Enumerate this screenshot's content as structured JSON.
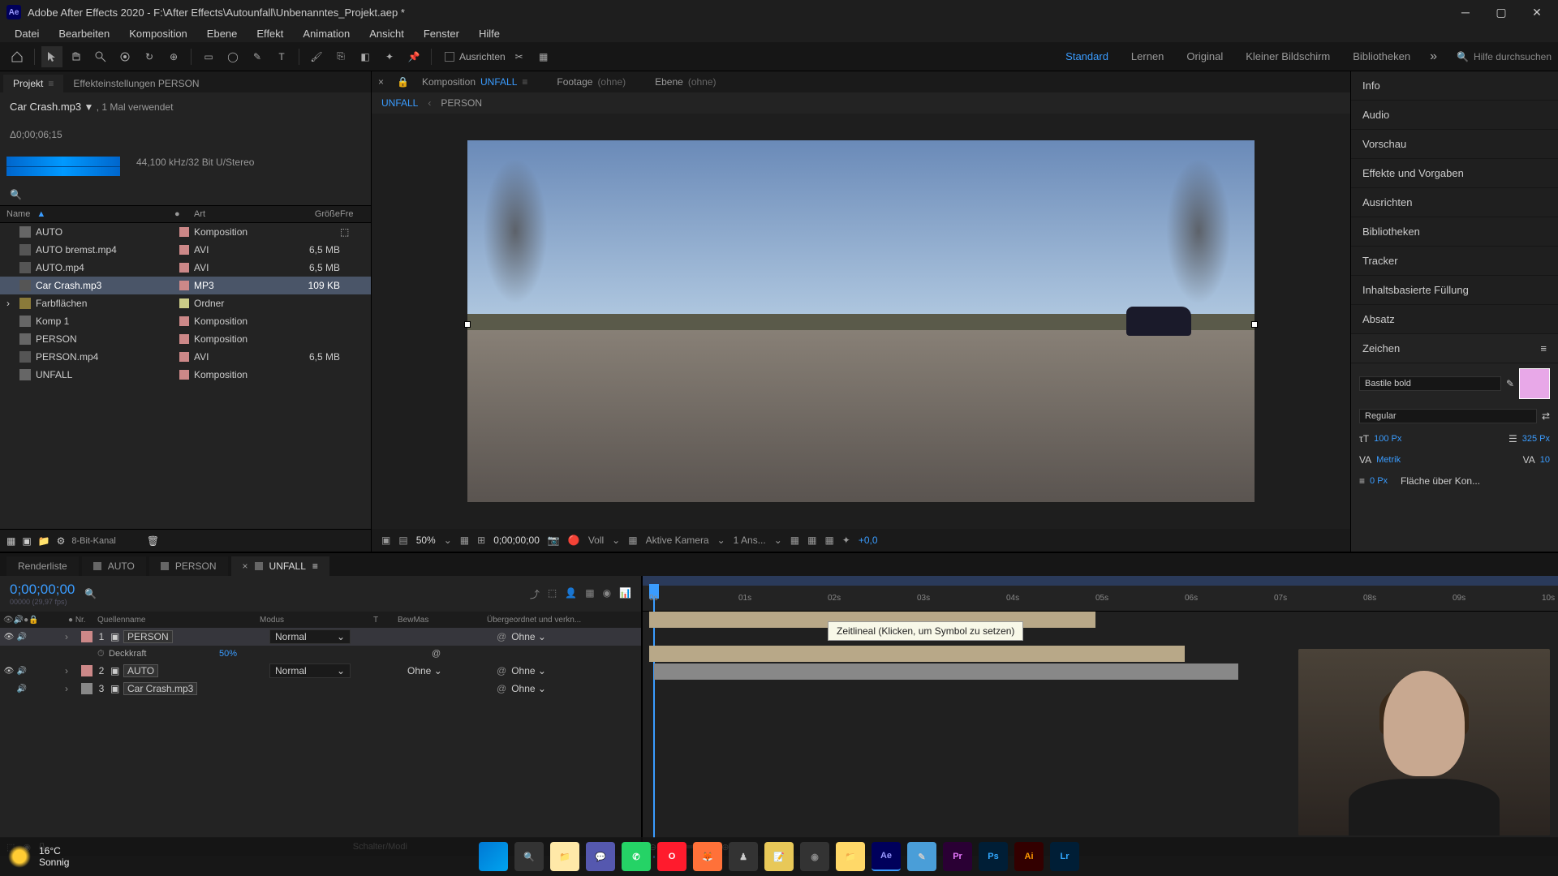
{
  "window": {
    "title": "Adobe After Effects 2020 - F:\\After Effects\\Autounfall\\Unbenanntes_Projekt.aep *"
  },
  "menu": [
    "Datei",
    "Bearbeiten",
    "Komposition",
    "Ebene",
    "Effekt",
    "Animation",
    "Ansicht",
    "Fenster",
    "Hilfe"
  ],
  "toolbar": {
    "ausrichten": "Ausrichten",
    "workspaces": [
      "Standard",
      "Lernen",
      "Original",
      "Kleiner Bildschirm",
      "Bibliotheken"
    ],
    "search_placeholder": "Hilfe durchsuchen"
  },
  "project": {
    "tab": "Projekt",
    "effect_tab": "Effekteinstellungen PERSON",
    "asset_name": "Car Crash.mp3",
    "asset_used": ", 1 Mal verwendet",
    "asset_duration": "Δ0;00;06;15",
    "asset_meta": "44,100 kHz/32 Bit U/Stereo",
    "columns": {
      "name": "Name",
      "type": "Art",
      "size": "Größe",
      "fre": "Fre"
    },
    "items": [
      {
        "name": "AUTO",
        "type": "Komposition",
        "size": "",
        "label": "pink",
        "icon": "comp",
        "link": true
      },
      {
        "name": "AUTO bremst.mp4",
        "type": "AVI",
        "size": "6,5 MB",
        "label": "pink",
        "icon": "file"
      },
      {
        "name": "AUTO.mp4",
        "type": "AVI",
        "size": "6,5 MB",
        "label": "pink",
        "icon": "file"
      },
      {
        "name": "Car Crash.mp3",
        "type": "MP3",
        "size": "109 KB",
        "label": "pink",
        "icon": "file",
        "selected": true
      },
      {
        "name": "Farbflächen",
        "type": "Ordner",
        "size": "",
        "label": "yellow",
        "icon": "folder",
        "expand": true
      },
      {
        "name": "Komp 1",
        "type": "Komposition",
        "size": "",
        "label": "pink",
        "icon": "comp"
      },
      {
        "name": "PERSON",
        "type": "Komposition",
        "size": "",
        "label": "pink",
        "icon": "comp"
      },
      {
        "name": "PERSON.mp4",
        "type": "AVI",
        "size": "6,5 MB",
        "label": "pink",
        "icon": "file"
      },
      {
        "name": "UNFALL",
        "type": "Komposition",
        "size": "",
        "label": "pink",
        "icon": "comp"
      }
    ],
    "footer_bpc": "8-Bit-Kanal"
  },
  "composition": {
    "tab_prefix": "Komposition",
    "comp_name": "UNFALL",
    "footage_label": "Footage",
    "footage_value": "(ohne)",
    "layer_label": "Ebene",
    "layer_value": "(ohne)",
    "breadcrumb": [
      "UNFALL",
      "PERSON"
    ],
    "controls": {
      "zoom": "50%",
      "timecode": "0;00;00;00",
      "res": "Voll",
      "view": "Aktive Kamera",
      "views": "1 Ans...",
      "exposure": "+0,0"
    }
  },
  "right_panels": [
    "Info",
    "Audio",
    "Vorschau",
    "Effekte und Vorgaben",
    "Ausrichten",
    "Bibliotheken",
    "Tracker",
    "Inhaltsbasierte Füllung",
    "Absatz"
  ],
  "zeichen": {
    "title": "Zeichen",
    "font": "Bastile bold",
    "style": "Regular",
    "size": "100 Px",
    "leading": "325 Px",
    "kerning": "Metrik",
    "tracking": "10",
    "baseline": "0 Px",
    "fill_label": "Fläche über Kon..."
  },
  "timeline": {
    "tabs": [
      {
        "label": "Renderliste"
      },
      {
        "label": "AUTO"
      },
      {
        "label": "PERSON"
      },
      {
        "label": "UNFALL",
        "active": true
      }
    ],
    "timecode": "0;00;00;00",
    "timecode_sub": "00000 (29,97 fps)",
    "columns": {
      "nr": "Nr.",
      "name": "Quellenname",
      "mode": "Modus",
      "t": "T",
      "bew": "BewMas",
      "parent": "Übergeordnet und verkn..."
    },
    "layers": [
      {
        "nr": "1",
        "name": "PERSON",
        "mode": "Normal",
        "bew": "",
        "parent": "Ohne",
        "selected": true,
        "label": "pink",
        "eye": true,
        "spk": true
      },
      {
        "nr": "2",
        "name": "AUTO",
        "mode": "Normal",
        "bew": "Ohne",
        "parent": "Ohne",
        "label": "pink",
        "eye": true,
        "spk": true
      },
      {
        "nr": "3",
        "name": "Car Crash.mp3",
        "mode": "",
        "bew": "",
        "parent": "Ohne",
        "label": "gray",
        "spk": true
      }
    ],
    "property": {
      "name": "Deckkraft",
      "value": "50%"
    },
    "footer": "Schalter/Modi",
    "ruler_ticks": [
      "0s",
      "01s",
      "02s",
      "03s",
      "04s",
      "05s",
      "06s",
      "07s",
      "08s",
      "09s",
      "10s"
    ],
    "tooltip": "Zeitlineal (Klicken, um Symbol zu setzen)"
  },
  "taskbar": {
    "temp": "16°C",
    "cond": "Sonnig",
    "apps": [
      "win",
      "search",
      "explorer",
      "teams",
      "wa",
      "opera",
      "ff",
      "fig",
      "fig2",
      "obs",
      "folder",
      "ae",
      "tool",
      "pr",
      "ps",
      "ai",
      "lr"
    ]
  }
}
